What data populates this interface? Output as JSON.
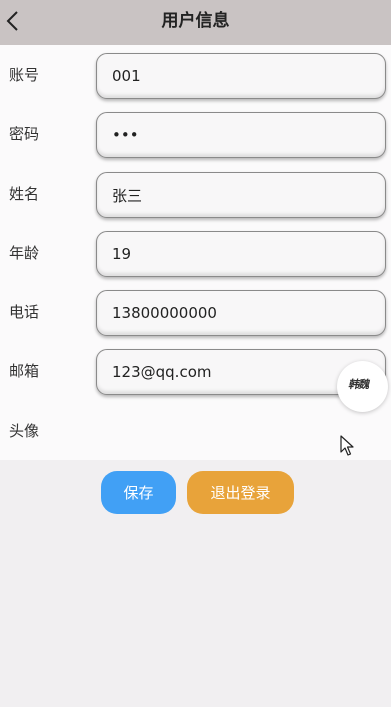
{
  "header": {
    "title": "用户信息"
  },
  "fields": [
    {
      "label": "账号",
      "value": "001",
      "type": "text"
    },
    {
      "label": "密码",
      "value": "123",
      "type": "password"
    },
    {
      "label": "姓名",
      "value": "张三",
      "type": "text"
    },
    {
      "label": "年龄",
      "value": "19",
      "type": "text"
    },
    {
      "label": "电话",
      "value": "13800000000",
      "type": "text"
    },
    {
      "label": "邮箱",
      "value": "123@qq.com",
      "type": "text"
    }
  ],
  "avatar": {
    "label": "头像",
    "signature_text": "韩魏"
  },
  "actions": {
    "save_label": "保存",
    "logout_label": "退出登录"
  },
  "colors": {
    "header_bg": "#c9c3c3",
    "save_button": "#41a0f5",
    "logout_button": "#e8a33a"
  },
  "icons": {
    "back": "chevron-left-icon",
    "cursor": "mouse-pointer-icon"
  }
}
